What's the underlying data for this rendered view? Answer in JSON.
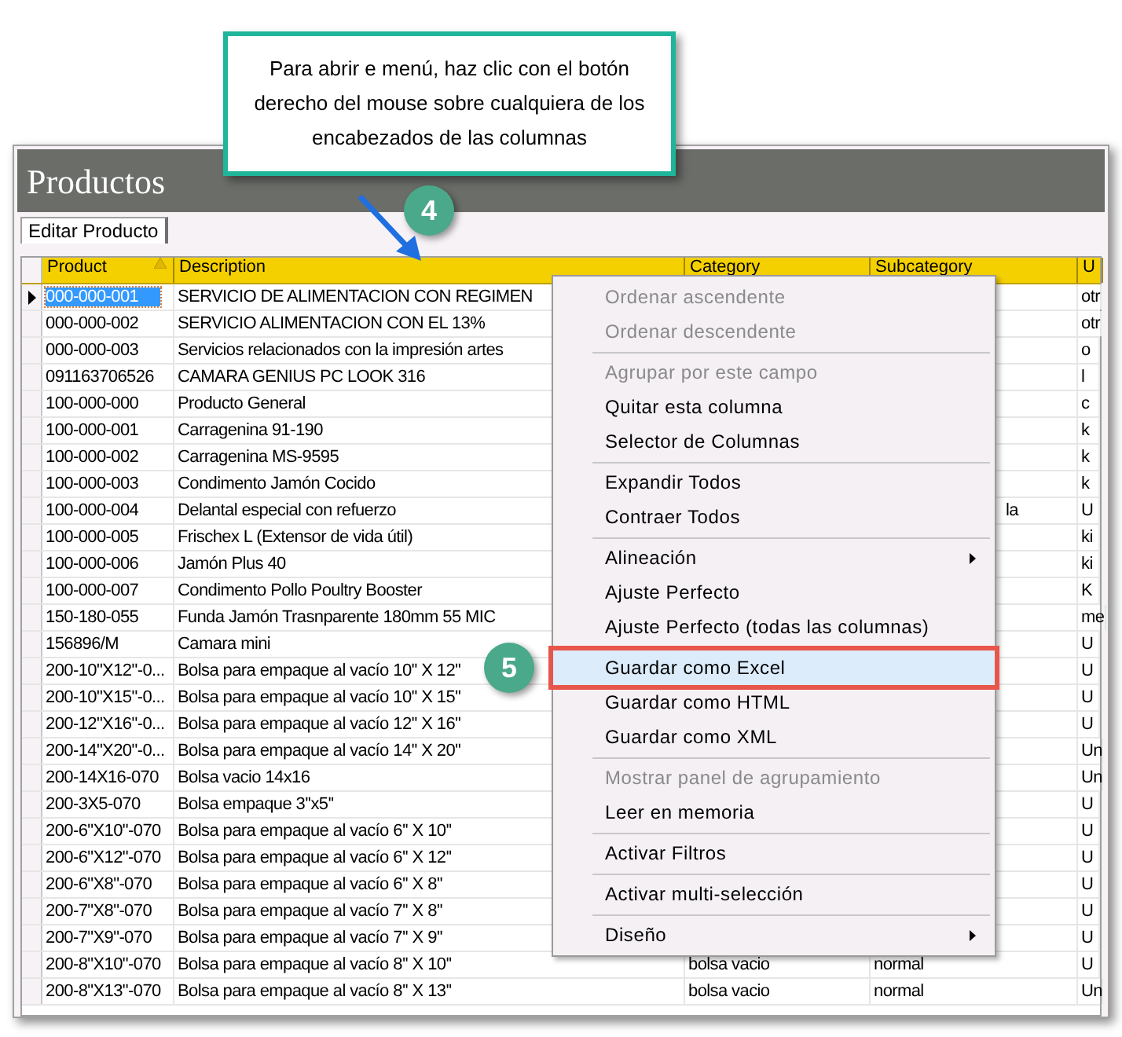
{
  "callout": {
    "text": "Para abrir e menú, haz clic con el botón derecho del mouse sobre cualquiera de los encabezados de las columnas"
  },
  "badges": [
    {
      "label": "4"
    },
    {
      "label": "5"
    }
  ],
  "window": {
    "title": "Productos"
  },
  "tabs": [
    {
      "label": "Editar Producto",
      "selected": true
    }
  ],
  "table": {
    "columns": [
      {
        "label": "Product",
        "sorted": true
      },
      {
        "label": "Description",
        "sorted": false
      },
      {
        "label": "Category",
        "sorted": false
      },
      {
        "label": "Subcategory",
        "sorted": false
      },
      {
        "label": "U",
        "sorted": false
      }
    ],
    "rows": [
      {
        "selected": true,
        "cells": [
          "000-000-001",
          "SERVICIO DE ALIMENTACION CON REGIMEN",
          "",
          "",
          "otr"
        ]
      },
      {
        "selected": false,
        "cells": [
          "000-000-002",
          "SERVICIO ALIMENTACION CON EL 13%",
          "",
          "",
          "otr"
        ]
      },
      {
        "selected": false,
        "cells": [
          "000-000-003",
          "Servicios relacionados con la impresión artes",
          "",
          "",
          "o"
        ]
      },
      {
        "selected": false,
        "cells": [
          "091163706526",
          "CAMARA GENIUS PC LOOK 316",
          "",
          "",
          "l"
        ]
      },
      {
        "selected": false,
        "cells": [
          "100-000-000",
          "Producto General",
          "",
          "",
          "c"
        ]
      },
      {
        "selected": false,
        "cells": [
          "100-000-001",
          "Carragenina 91-190",
          "",
          "",
          "k"
        ]
      },
      {
        "selected": false,
        "cells": [
          "100-000-002",
          "Carragenina MS-9595",
          "",
          "",
          "k"
        ]
      },
      {
        "selected": false,
        "cells": [
          "100-000-003",
          "Condimento Jamón Cocido",
          "",
          "",
          "k"
        ]
      },
      {
        "selected": false,
        "cells": [
          "100-000-004",
          "Delantal especial con refuerzo",
          "",
          "la",
          "U"
        ]
      },
      {
        "selected": false,
        "cells": [
          "100-000-005",
          "Frischex L (Extensor de vida útil)",
          "",
          "",
          "ki"
        ]
      },
      {
        "selected": false,
        "cells": [
          "100-000-006",
          "Jamón Plus 40",
          "",
          "",
          "ki"
        ]
      },
      {
        "selected": false,
        "cells": [
          "100-000-007",
          "Condimento Pollo Poultry Booster",
          "",
          "",
          "K"
        ]
      },
      {
        "selected": false,
        "cells": [
          "150-180-055",
          "Funda Jamón Trasnparente 180mm 55 MIC",
          "",
          "",
          "me"
        ]
      },
      {
        "selected": false,
        "cells": [
          "156896/M",
          "Camara mini",
          "",
          "",
          "U"
        ]
      },
      {
        "selected": false,
        "cells": [
          "200-10\"X12\"-0...",
          "Bolsa para empaque al vacío 10'' X 12''",
          "",
          "",
          "U"
        ]
      },
      {
        "selected": false,
        "cells": [
          "200-10\"X15\"-0...",
          "Bolsa para empaque al vacío 10'' X 15''",
          "",
          "",
          "U"
        ]
      },
      {
        "selected": false,
        "cells": [
          "200-12\"X16\"-0...",
          "Bolsa para empaque al vacío 12'' X 16''",
          "",
          "",
          "U"
        ]
      },
      {
        "selected": false,
        "cells": [
          "200-14\"X20\"-0...",
          "Bolsa para empaque al vacío 14'' X 20''",
          "",
          "",
          "Un"
        ]
      },
      {
        "selected": false,
        "cells": [
          "200-14X16-070",
          "Bolsa vacio 14x16",
          "",
          "",
          "Un"
        ]
      },
      {
        "selected": false,
        "cells": [
          "200-3X5-070",
          "Bolsa empaque 3''x5''",
          "",
          "",
          "U"
        ]
      },
      {
        "selected": false,
        "cells": [
          "200-6\"X10\"-070",
          "Bolsa para empaque al vacío 6'' X 10''",
          "",
          "",
          "U"
        ]
      },
      {
        "selected": false,
        "cells": [
          "200-6\"X12\"-070",
          "Bolsa para empaque al vacío 6'' X 12''",
          "",
          "",
          "U"
        ]
      },
      {
        "selected": false,
        "cells": [
          "200-6\"X8\"-070",
          "Bolsa para empaque al vacío 6'' X 8''",
          "",
          "",
          "U"
        ]
      },
      {
        "selected": false,
        "cells": [
          "200-7\"X8\"-070",
          "Bolsa para empaque al vacío 7'' X 8''",
          "",
          "",
          "U"
        ]
      },
      {
        "selected": false,
        "cells": [
          "200-7\"X9\"-070",
          "Bolsa para empaque al vacío 7'' X 9''",
          "",
          "",
          "U"
        ]
      },
      {
        "selected": false,
        "cells": [
          "200-8\"X10\"-070",
          "Bolsa para empaque al vacío 8'' X 10''",
          "bolsa vacio",
          "normal",
          "U"
        ]
      },
      {
        "selected": false,
        "cells": [
          "200-8\"X13\"-070",
          "Bolsa para empaque al vacío 8'' X 13''",
          "bolsa vacio",
          "normal",
          "Un"
        ]
      }
    ]
  },
  "context_menu": {
    "items": [
      {
        "kind": "item",
        "label": "Ordenar ascendente",
        "disabled": true,
        "submenu": false,
        "selected": false
      },
      {
        "kind": "item",
        "label": "Ordenar descendente",
        "disabled": true,
        "submenu": false,
        "selected": false
      },
      {
        "kind": "separator"
      },
      {
        "kind": "item",
        "label": "Agrupar por este campo",
        "disabled": true,
        "submenu": false,
        "selected": false
      },
      {
        "kind": "item",
        "label": "Quitar esta columna",
        "disabled": false,
        "submenu": false,
        "selected": false
      },
      {
        "kind": "item",
        "label": "Selector de Columnas",
        "disabled": false,
        "submenu": false,
        "selected": false
      },
      {
        "kind": "separator"
      },
      {
        "kind": "item",
        "label": "Expandir Todos",
        "disabled": false,
        "submenu": false,
        "selected": false
      },
      {
        "kind": "item",
        "label": "Contraer Todos",
        "disabled": false,
        "submenu": false,
        "selected": false
      },
      {
        "kind": "separator"
      },
      {
        "kind": "item",
        "label": "Alineación",
        "disabled": false,
        "submenu": true,
        "selected": false
      },
      {
        "kind": "item",
        "label": "Ajuste Perfecto",
        "disabled": false,
        "submenu": false,
        "selected": false
      },
      {
        "kind": "item",
        "label": "Ajuste Perfecto (todas las columnas)",
        "disabled": false,
        "submenu": false,
        "selected": false
      },
      {
        "kind": "separator"
      },
      {
        "kind": "item",
        "label": "Guardar como Excel",
        "disabled": false,
        "submenu": false,
        "selected": true
      },
      {
        "kind": "item",
        "label": "Guardar como HTML",
        "disabled": false,
        "submenu": false,
        "selected": false
      },
      {
        "kind": "item",
        "label": "Guardar como XML",
        "disabled": false,
        "submenu": false,
        "selected": false
      },
      {
        "kind": "separator"
      },
      {
        "kind": "item",
        "label": "Mostrar panel de agrupamiento",
        "disabled": true,
        "submenu": false,
        "selected": false
      },
      {
        "kind": "item",
        "label": "Leer en memoria",
        "disabled": false,
        "submenu": false,
        "selected": false
      },
      {
        "kind": "separator"
      },
      {
        "kind": "item",
        "label": "Activar Filtros",
        "disabled": false,
        "submenu": false,
        "selected": false
      },
      {
        "kind": "separator"
      },
      {
        "kind": "item",
        "label": "Activar multi-selección",
        "disabled": false,
        "submenu": false,
        "selected": false
      },
      {
        "kind": "separator"
      },
      {
        "kind": "item",
        "label": "Diseño",
        "disabled": false,
        "submenu": true,
        "selected": false
      }
    ]
  }
}
